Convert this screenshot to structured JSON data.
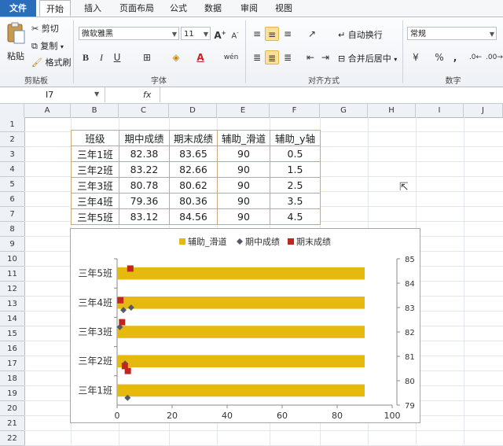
{
  "ribbon_tabs": [
    "文件",
    "开始",
    "插入",
    "页面布局",
    "公式",
    "数据",
    "审阅",
    "视图"
  ],
  "clipboard": {
    "paste": "粘贴",
    "cut": "剪切",
    "copy": "复制",
    "format_painter": "格式刷",
    "group": "剪贴板"
  },
  "font": {
    "name": "微软雅黑",
    "size": "11",
    "bold": "B",
    "italic": "I",
    "underline": "U",
    "wen": "wén",
    "group": "字体"
  },
  "alignment": {
    "wrap": "自动换行",
    "merge": "合并后居中",
    "group": "对齐方式"
  },
  "number": {
    "format": "常规",
    "percent": "%",
    "comma": ",",
    "group": "数字"
  },
  "formula_bar": {
    "name_box": "I7",
    "fx": "fx",
    "value": ""
  },
  "columns": [
    "A",
    "B",
    "C",
    "D",
    "E",
    "F",
    "G",
    "H",
    "I",
    "J"
  ],
  "rows": [
    "1",
    "2",
    "3",
    "4",
    "5",
    "6",
    "7",
    "8",
    "9",
    "10",
    "11",
    "12",
    "13",
    "14",
    "15",
    "16",
    "17",
    "18",
    "19",
    "20",
    "21",
    "22"
  ],
  "table": {
    "headers": [
      "班级",
      "期中成绩",
      "期末成绩",
      "辅助_滑道",
      "辅助_y轴"
    ],
    "rows": [
      [
        "三年1班",
        "82.38",
        "83.65",
        "90",
        "0.5"
      ],
      [
        "三年2班",
        "83.22",
        "82.66",
        "90",
        "1.5"
      ],
      [
        "三年3班",
        "80.78",
        "80.62",
        "90",
        "2.5"
      ],
      [
        "三年4班",
        "79.36",
        "80.36",
        "90",
        "3.5"
      ],
      [
        "三年5班",
        "83.12",
        "84.56",
        "90",
        "4.5"
      ]
    ]
  },
  "chart_data": {
    "type": "bar",
    "legend_position": "top",
    "legend": [
      {
        "name": "辅助_滑道",
        "color": "#e6b90f",
        "marker": "square"
      },
      {
        "name": "期中成绩",
        "color": "#555a66",
        "marker": "diamond"
      },
      {
        "name": "期末成绩",
        "color": "#c0261d",
        "marker": "square"
      }
    ],
    "categories": [
      "三年1班",
      "三年2班",
      "三年3班",
      "三年4班",
      "三年5班"
    ],
    "bar_values": [
      90,
      90,
      90,
      90,
      90
    ],
    "x_ticks": [
      "0",
      "20",
      "40",
      "60",
      "80",
      "100"
    ],
    "xlim": [
      0,
      100
    ],
    "y2_ticks": [
      "79",
      "80",
      "81",
      "82",
      "83",
      "84",
      "85"
    ],
    "y2lim": [
      79,
      85
    ],
    "midterm_points": [
      {
        "x": 3.8,
        "y": 79.3
      },
      {
        "x": 2.9,
        "y": 80.7
      },
      {
        "x": 1.0,
        "y": 82.2
      },
      {
        "x": 2.3,
        "y": 82.9
      },
      {
        "x": 5.1,
        "y": 83.0
      }
    ],
    "final_points": [
      {
        "x": 3.9,
        "y": 80.4
      },
      {
        "x": 2.8,
        "y": 80.6
      },
      {
        "x": 1.8,
        "y": 82.4
      },
      {
        "x": 1.2,
        "y": 83.3
      },
      {
        "x": 4.8,
        "y": 84.6
      }
    ],
    "colors": {
      "bar": "#e6b90f",
      "midterm": "#555a66",
      "final": "#c0261d"
    }
  }
}
